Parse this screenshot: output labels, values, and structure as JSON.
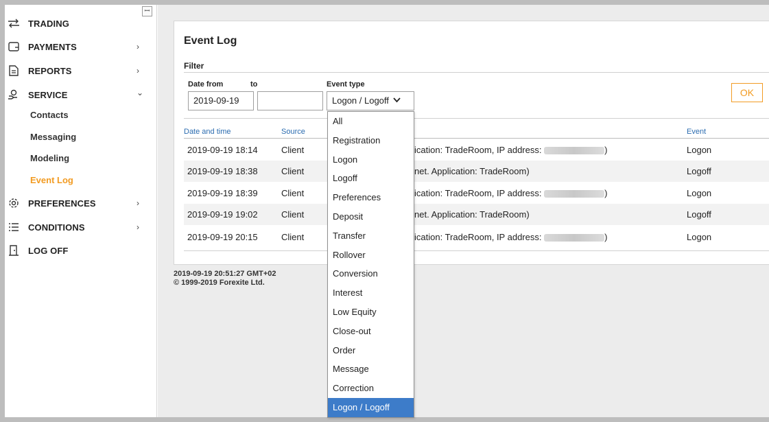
{
  "sidebar": {
    "pin_icon": "pin-icon",
    "items": [
      {
        "label": "TRADING",
        "icon": "swap-arrows-icon",
        "chevron": ""
      },
      {
        "label": "PAYMENTS",
        "icon": "wallet-icon",
        "chevron": "›"
      },
      {
        "label": "REPORTS",
        "icon": "document-icon",
        "chevron": "›"
      },
      {
        "label": "SERVICE",
        "icon": "support-hand-icon",
        "chevron": "⌄"
      },
      {
        "label": "PREFERENCES",
        "icon": "gear-icon",
        "chevron": "›"
      },
      {
        "label": "CONDITIONS",
        "icon": "list-icon",
        "chevron": "›"
      },
      {
        "label": "LOG OFF",
        "icon": "logoff-door-icon",
        "chevron": ""
      }
    ],
    "service_sub": [
      "Contacts",
      "Messaging",
      "Modeling",
      "Event Log"
    ],
    "active_sub": "Event Log"
  },
  "page": {
    "title": "Event Log",
    "filter": {
      "title": "Filter",
      "date_from_label": "Date from",
      "to_label": "to",
      "date_from_value": "2019-09-19",
      "date_to_value": "",
      "event_type_label": "Event type",
      "event_type_value": "Logon / Logoff",
      "ok_label": "OK"
    },
    "table": {
      "headers": {
        "datetime": "Date and time",
        "source": "Source",
        "event": "Event"
      },
      "rows": [
        {
          "datetime": "2019-09-19 18:14",
          "source": "Client",
          "details": "ication: TradeRoom, IP address:",
          "details_tail": ")",
          "event": "Logon"
        },
        {
          "datetime": "2019-09-19 18:38",
          "source": "Client",
          "details": "net. Application: TradeRoom)",
          "details_tail": "",
          "event": "Logoff"
        },
        {
          "datetime": "2019-09-19 18:39",
          "source": "Client",
          "details": "ication: TradeRoom, IP address:",
          "details_tail": ")",
          "event": "Logon"
        },
        {
          "datetime": "2019-09-19 19:02",
          "source": "Client",
          "details": "net. Application: TradeRoom)",
          "details_tail": "",
          "event": "Logoff"
        },
        {
          "datetime": "2019-09-19 20:15",
          "source": "Client",
          "details": "ication: TradeRoom, IP address:",
          "details_tail": ")",
          "event": "Logon"
        }
      ]
    },
    "footer": {
      "timestamp": "2019-09-19 20:51:27 GMT+02",
      "copyright": "© 1999-2019 Forexite Ltd."
    }
  },
  "dropdown": {
    "options": [
      "All",
      "Registration",
      "Logon",
      "Logoff",
      "Preferences",
      "Deposit",
      "Transfer",
      "Rollover",
      "Conversion",
      "Interest",
      "Low Equity",
      "Close-out",
      "Order",
      "Message",
      "Correction",
      "Logon / Logoff"
    ],
    "selected": "Logon / Logoff"
  },
  "colors": {
    "accent": "#f29b22",
    "header_link": "#2b6cb0",
    "selected_option": "#3d7cc9"
  }
}
